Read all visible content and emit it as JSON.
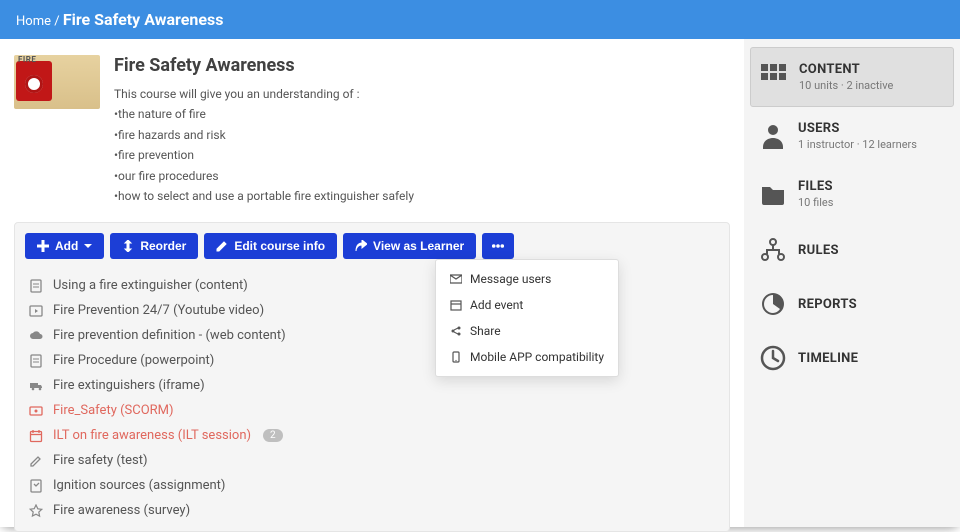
{
  "breadcrumb": {
    "home": "Home",
    "sep": "/",
    "page": "Fire Safety Awareness"
  },
  "course": {
    "title": "Fire Safety Awareness",
    "thumb_label": "FIRE",
    "desc_intro": "This course will give you an understanding of :",
    "desc_lines": [
      "•the nature of fire",
      "•fire hazards and risk",
      "•fire prevention",
      "•our fire procedures",
      "•how to select and use a portable fire extinguisher safely"
    ]
  },
  "toolbar": {
    "add": "Add",
    "reorder": "Reorder",
    "edit": "Edit course info",
    "view_as": "View as Learner",
    "more_items": [
      "Message users",
      "Add event",
      "Share",
      "Mobile APP compatibility"
    ]
  },
  "content": [
    {
      "icon": "doc",
      "label": "Using a fire extinguisher (content)"
    },
    {
      "icon": "video",
      "label": "Fire Prevention 24/7 (Youtube video)"
    },
    {
      "icon": "cloud",
      "label": "Fire prevention definition - (web content)"
    },
    {
      "icon": "doc",
      "label": "Fire Procedure (powerpoint)"
    },
    {
      "icon": "truck",
      "label": "Fire extinguishers (iframe)"
    },
    {
      "icon": "scorm",
      "label": "Fire_Safety (SCORM)",
      "red": true
    },
    {
      "icon": "calendar",
      "label": "ILT on fire awareness (ILT session)",
      "red": true,
      "badge": "2"
    },
    {
      "icon": "edit",
      "label": "Fire safety (test)"
    },
    {
      "icon": "assign",
      "label": "Ignition sources (assignment)"
    },
    {
      "icon": "star",
      "label": "Fire awareness (survey)"
    }
  ],
  "sidebar": [
    {
      "icon": "grid",
      "label": "CONTENT",
      "sub": "10 units · 2 inactive",
      "active": true
    },
    {
      "icon": "user",
      "label": "USERS",
      "sub": "1 instructor · 12 learners"
    },
    {
      "icon": "folder",
      "label": "FILES",
      "sub": "10 files"
    },
    {
      "icon": "rules",
      "label": "RULES"
    },
    {
      "icon": "reports",
      "label": "REPORTS"
    },
    {
      "icon": "clock",
      "label": "TIMELINE"
    }
  ]
}
